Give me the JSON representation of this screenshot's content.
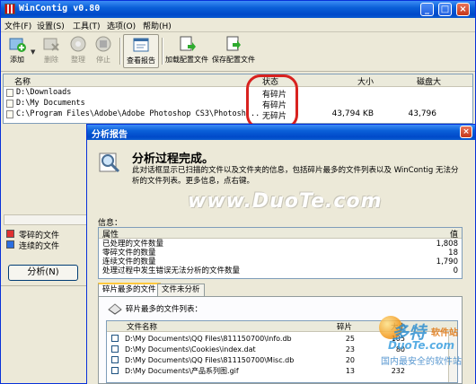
{
  "window": {
    "title": "WinContig v0.80",
    "minimize": "_",
    "maximize": "□",
    "close": "×"
  },
  "menu": [
    "文件(F)",
    "设置(S)",
    "工具(T)",
    "选项(O)",
    "帮助(H)"
  ],
  "toolbar": {
    "add": "添加",
    "remove": "删除",
    "defrag": "整理",
    "stop": "停止",
    "view_report": "查看报告",
    "load_profile": "加载配置文件",
    "save_profile": "保存配置文件"
  },
  "file_list": {
    "columns": {
      "name": "名称",
      "status": "状态",
      "size": "大小",
      "disk_size": "磁盘大"
    },
    "rows": [
      {
        "path": "D:\\Downloads",
        "status": "有碎片",
        "size": "",
        "disk_size": ""
      },
      {
        "path": "D:\\My Documents",
        "status": "有碎片",
        "size": "",
        "disk_size": ""
      },
      {
        "path": "C:\\Program Files\\Adobe\\Adobe Photoshop CS3\\Photosh...",
        "status": "无碎片",
        "size": "43,794 KB",
        "disk_size": "43,796"
      }
    ]
  },
  "legend": [
    "零碎的文件",
    "连续的文件"
  ],
  "analyze_button": "分析(N)",
  "dialog": {
    "title": "分析报告",
    "close": "×",
    "heading": "分析过程完成。",
    "description": "此对话框显示已扫描的文件以及文件夹的信息，包括碎片最多的文件列表以及 WinContig 无法分析的文件列表。更多信息，点右键。",
    "watermark": "www.DuoTe.com",
    "info_label": "信息：",
    "info_columns": {
      "property": "属性",
      "value": "值"
    },
    "info_rows": [
      {
        "name": "已处理的文件数量",
        "value": "1,808"
      },
      {
        "name": "零碎文件的数量",
        "value": "18"
      },
      {
        "name": "连续文件的数量",
        "value": "1,790"
      },
      {
        "name": "处理过程中发生错误无法分析的文件数量",
        "value": "0"
      }
    ],
    "tabs": [
      "碎片最多的文件",
      "文件未分析"
    ],
    "frag_title": "碎片最多的文件列表：",
    "frag_columns": {
      "name": "文件名称",
      "fragments": "碎片",
      "size": "大小"
    },
    "frag_rows": [
      {
        "name": "D:\\My Documents\\QQ Files\\811150700\\Info.db",
        "fragments": "25",
        "size": "105"
      },
      {
        "name": "D:\\My Documents\\Cookies\\index.dat",
        "fragments": "23",
        "size": "80"
      },
      {
        "name": "D:\\My Documents\\QQ Files\\811150700\\Misc.db",
        "fragments": "20",
        "size": ""
      },
      {
        "name": "D:\\My Documents\\产品系列图.gif",
        "fragments": "13",
        "size": "232"
      }
    ]
  },
  "site_logo": {
    "brand": "多特",
    "sub": "软件站",
    "domain": "DuoTe.com",
    "tagline": "国内最安全的软件站"
  }
}
